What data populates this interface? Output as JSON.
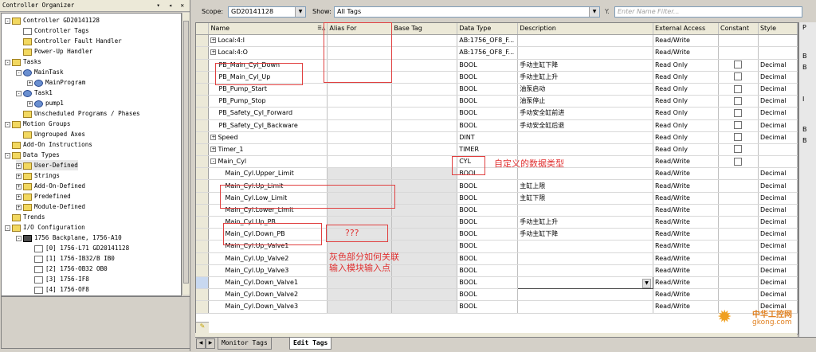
{
  "organizer": {
    "title": "Controller Organizer",
    "tree": [
      {
        "label": "Controller GD20141128",
        "level": 0,
        "icon": "folder",
        "pm": "-"
      },
      {
        "label": "Controller Tags",
        "level": 1,
        "icon": "doc",
        "pm": ""
      },
      {
        "label": "Controller Fault Handler",
        "level": 1,
        "icon": "folder",
        "pm": ""
      },
      {
        "label": "Power-Up Handler",
        "level": 1,
        "icon": "folder",
        "pm": ""
      },
      {
        "label": "Tasks",
        "level": 0,
        "icon": "folder",
        "pm": "-"
      },
      {
        "label": "MainTask",
        "level": 1,
        "icon": "gear",
        "pm": "-"
      },
      {
        "label": "MainProgram",
        "level": 2,
        "icon": "gear",
        "pm": "+"
      },
      {
        "label": "Task1",
        "level": 1,
        "icon": "gear",
        "pm": "-"
      },
      {
        "label": "pump1",
        "level": 2,
        "icon": "gear",
        "pm": "+"
      },
      {
        "label": "Unscheduled Programs / Phases",
        "level": 1,
        "icon": "folder",
        "pm": ""
      },
      {
        "label": "Motion Groups",
        "level": 0,
        "icon": "folder",
        "pm": "-"
      },
      {
        "label": "Ungrouped Axes",
        "level": 1,
        "icon": "folder",
        "pm": ""
      },
      {
        "label": "Add-On Instructions",
        "level": 0,
        "icon": "folder",
        "pm": ""
      },
      {
        "label": "Data Types",
        "level": 0,
        "icon": "folder",
        "pm": "-"
      },
      {
        "label": "User-Defined",
        "level": 1,
        "icon": "folder",
        "pm": "+",
        "selected": true
      },
      {
        "label": "Strings",
        "level": 1,
        "icon": "folder",
        "pm": "+"
      },
      {
        "label": "Add-On-Defined",
        "level": 1,
        "icon": "folder",
        "pm": "+"
      },
      {
        "label": "Predefined",
        "level": 1,
        "icon": "folder",
        "pm": "+"
      },
      {
        "label": "Module-Defined",
        "level": 1,
        "icon": "folder",
        "pm": "+"
      },
      {
        "label": "Trends",
        "level": 0,
        "icon": "folder",
        "pm": ""
      },
      {
        "label": "I/O Configuration",
        "level": 0,
        "icon": "folder",
        "pm": "-"
      },
      {
        "label": "1756 Backplane, 1756-A10",
        "level": 1,
        "icon": "chip",
        "pm": "-"
      },
      {
        "label": "[0] 1756-L71 GD20141128",
        "level": 2,
        "icon": "doc",
        "pm": ""
      },
      {
        "label": "[1] 1756-IB32/B IB0",
        "level": 2,
        "icon": "doc",
        "pm": ""
      },
      {
        "label": "[2] 1756-OB32 OB0",
        "level": 2,
        "icon": "doc",
        "pm": ""
      },
      {
        "label": "[3] 1756-IF8",
        "level": 2,
        "icon": "doc",
        "pm": ""
      },
      {
        "label": "[4] 1756-OF8",
        "level": 2,
        "icon": "doc",
        "pm": ""
      }
    ]
  },
  "toolbar": {
    "scope_label": "Scope:",
    "scope_value": "GD20141128",
    "show_label": "Show:",
    "show_value": "All Tags",
    "filter_placeholder": "Enter Name Filter..."
  },
  "grid": {
    "columns": [
      "Name",
      "Alias For",
      "Base Tag",
      "Data Type",
      "Description",
      "External Access",
      "Constant",
      "Style"
    ],
    "rows": [
      {
        "name": "Local:4:I",
        "expand": "+",
        "indent": 0,
        "alias": "",
        "base": "",
        "type": "AB:1756_OF8_F...",
        "desc": "",
        "access": "Read/Write",
        "constant": false,
        "style": "",
        "gray": false
      },
      {
        "name": "Local:4:O",
        "expand": "+",
        "indent": 0,
        "alias": "",
        "base": "",
        "type": "AB:1756_OF8_F...",
        "desc": "",
        "access": "Read/Write",
        "constant": false,
        "style": "",
        "gray": false
      },
      {
        "name": "PB_Main_Cyl_Down",
        "expand": "",
        "indent": 0,
        "alias": "",
        "base": "",
        "type": "BOOL",
        "desc": "手动主缸下降",
        "access": "Read Only",
        "constant": true,
        "style": "Decimal",
        "gray": false
      },
      {
        "name": "PB_Main_Cyl_Up",
        "expand": "",
        "indent": 0,
        "alias": "",
        "base": "",
        "type": "BOOL",
        "desc": "手动主缸上升",
        "access": "Read Only",
        "constant": true,
        "style": "Decimal",
        "gray": false
      },
      {
        "name": "PB_Pump_Start",
        "expand": "",
        "indent": 0,
        "alias": "",
        "base": "",
        "type": "BOOL",
        "desc": "油泵启动",
        "access": "Read Only",
        "constant": true,
        "style": "Decimal",
        "gray": false
      },
      {
        "name": "PB_Pump_Stop",
        "expand": "",
        "indent": 0,
        "alias": "",
        "base": "",
        "type": "BOOL",
        "desc": "油泵停止",
        "access": "Read Only",
        "constant": true,
        "style": "Decimal",
        "gray": false
      },
      {
        "name": "PB_Safety_Cyl_Forward",
        "expand": "",
        "indent": 0,
        "alias": "",
        "base": "",
        "type": "BOOL",
        "desc": "手动安全缸前进",
        "access": "Read Only",
        "constant": true,
        "style": "Decimal",
        "gray": false
      },
      {
        "name": "PB_Safety_Cyl_Backware",
        "expand": "",
        "indent": 0,
        "alias": "",
        "base": "",
        "type": "BOOL",
        "desc": "手动安全缸后退",
        "access": "Read Only",
        "constant": true,
        "style": "Decimal",
        "gray": false
      },
      {
        "name": "Speed",
        "expand": "+",
        "indent": 0,
        "alias": "",
        "base": "",
        "type": "DINT",
        "desc": "",
        "access": "Read Only",
        "constant": true,
        "style": "Decimal",
        "gray": false
      },
      {
        "name": "Timer_1",
        "expand": "+",
        "indent": 0,
        "alias": "",
        "base": "",
        "type": "TIMER",
        "desc": "",
        "access": "Read Only",
        "constant": true,
        "style": "",
        "gray": false
      },
      {
        "name": "Main_Cyl",
        "expand": "-",
        "indent": 0,
        "alias": "",
        "base": "",
        "type": "CYL",
        "desc": "",
        "access": "Read/Write",
        "constant": true,
        "style": "",
        "gray": false
      },
      {
        "name": "Main_Cyl.Upper_Limit",
        "expand": "",
        "indent": 1,
        "alias": "",
        "base": "",
        "type": "BOOL",
        "desc": "",
        "access": "Read/Write",
        "constant": false,
        "style": "Decimal",
        "gray": true
      },
      {
        "name": "Main_Cyl.Up_Limit",
        "expand": "",
        "indent": 1,
        "alias": "",
        "base": "",
        "type": "BOOL",
        "desc": "主缸上限",
        "access": "Read/Write",
        "constant": false,
        "style": "Decimal",
        "gray": true
      },
      {
        "name": "Main_Cyl.Low_Limit",
        "expand": "",
        "indent": 1,
        "alias": "",
        "base": "",
        "type": "BOOL",
        "desc": "主缸下限",
        "access": "Read/Write",
        "constant": false,
        "style": "Decimal",
        "gray": true
      },
      {
        "name": "Main_Cyl.Lower_Limit",
        "expand": "",
        "indent": 1,
        "alias": "",
        "base": "",
        "type": "BOOL",
        "desc": "",
        "access": "Read/Write",
        "constant": false,
        "style": "Decimal",
        "gray": true
      },
      {
        "name": "Main_Cyl.Up_PB",
        "expand": "",
        "indent": 1,
        "alias": "",
        "base": "",
        "type": "BOOL",
        "desc": "手动主缸上升",
        "access": "Read/Write",
        "constant": false,
        "style": "Decimal",
        "gray": true
      },
      {
        "name": "Main_Cyl.Down_PB",
        "expand": "",
        "indent": 1,
        "alias": "",
        "base": "",
        "type": "BOOL",
        "desc": "手动主缸下降",
        "access": "Read/Write",
        "constant": false,
        "style": "Decimal",
        "gray": true
      },
      {
        "name": "Main_Cyl.Up_Valve1",
        "expand": "",
        "indent": 1,
        "alias": "",
        "base": "",
        "type": "BOOL",
        "desc": "",
        "access": "Read/Write",
        "constant": false,
        "style": "Decimal",
        "gray": true
      },
      {
        "name": "Main_Cyl.Up_Valve2",
        "expand": "",
        "indent": 1,
        "alias": "",
        "base": "",
        "type": "BOOL",
        "desc": "",
        "access": "Read/Write",
        "constant": false,
        "style": "Decimal",
        "gray": true
      },
      {
        "name": "Main_Cyl.Up_Valve3",
        "expand": "",
        "indent": 1,
        "alias": "",
        "base": "",
        "type": "BOOL",
        "desc": "",
        "access": "Read/Write",
        "constant": false,
        "style": "Decimal",
        "gray": true
      },
      {
        "name": "Main_Cyl.Down_Valve1",
        "expand": "",
        "indent": 1,
        "alias": "",
        "base": "",
        "type": "BOOL",
        "desc": "",
        "access": "Read/Write",
        "constant": false,
        "style": "Decimal",
        "gray": true,
        "descDropdown": true
      },
      {
        "name": "Main_Cyl.Down_Valve2",
        "expand": "",
        "indent": 1,
        "alias": "",
        "base": "",
        "type": "BOOL",
        "desc": "",
        "access": "Read/Write",
        "constant": false,
        "style": "Decimal",
        "gray": true
      },
      {
        "name": "Main_Cyl.Down_Valve3",
        "expand": "",
        "indent": 1,
        "alias": "",
        "base": "",
        "type": "BOOL",
        "desc": "",
        "access": "Read/Write",
        "constant": false,
        "style": "Decimal",
        "gray": true
      }
    ]
  },
  "right_panel": {
    "letters": [
      "P",
      "B",
      "B",
      "I",
      "B",
      "B"
    ]
  },
  "tabs": {
    "monitor": "Monitor Tags",
    "edit": "Edit Tags"
  },
  "annotations": {
    "udt_note": "自定义的数据类型",
    "question": "???",
    "gray_note_line1": "灰色部分如何关联",
    "gray_note_line2": "输入模块输入点"
  },
  "watermark": {
    "cn": "中华工控网",
    "url": "gkong.com"
  },
  "colors": {
    "annotation_red": "#e03030",
    "header_bg": "#ece9d8",
    "gray_cell": "#e4e4e4"
  }
}
